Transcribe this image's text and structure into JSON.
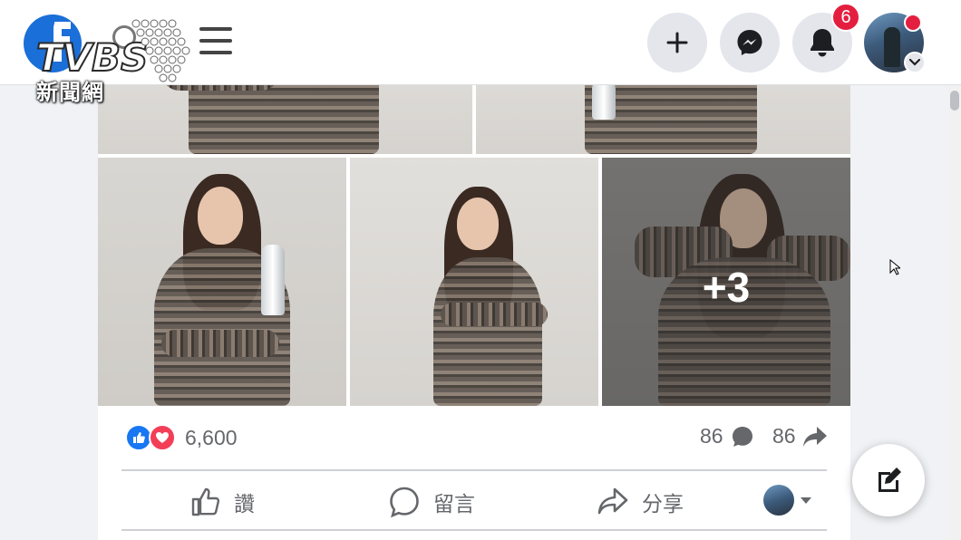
{
  "logo": {
    "brand": "TVBS",
    "subtitle": "新聞網"
  },
  "header": {
    "notifications_count": "6",
    "icons": [
      "menu-icon",
      "search-icon",
      "plus-icon",
      "messenger-icon",
      "bell-icon",
      "chevron-down-icon"
    ]
  },
  "post": {
    "more_photos_label": "+3",
    "reactions": {
      "count": "6,600",
      "types": [
        "like",
        "love"
      ]
    },
    "comments_count": "86",
    "shares_count": "86",
    "actions": {
      "like": "讚",
      "comment": "留言",
      "share": "分享"
    }
  },
  "colors": {
    "accent": "#1877f2",
    "badge": "#e41e3f",
    "love": "#f33e58"
  }
}
